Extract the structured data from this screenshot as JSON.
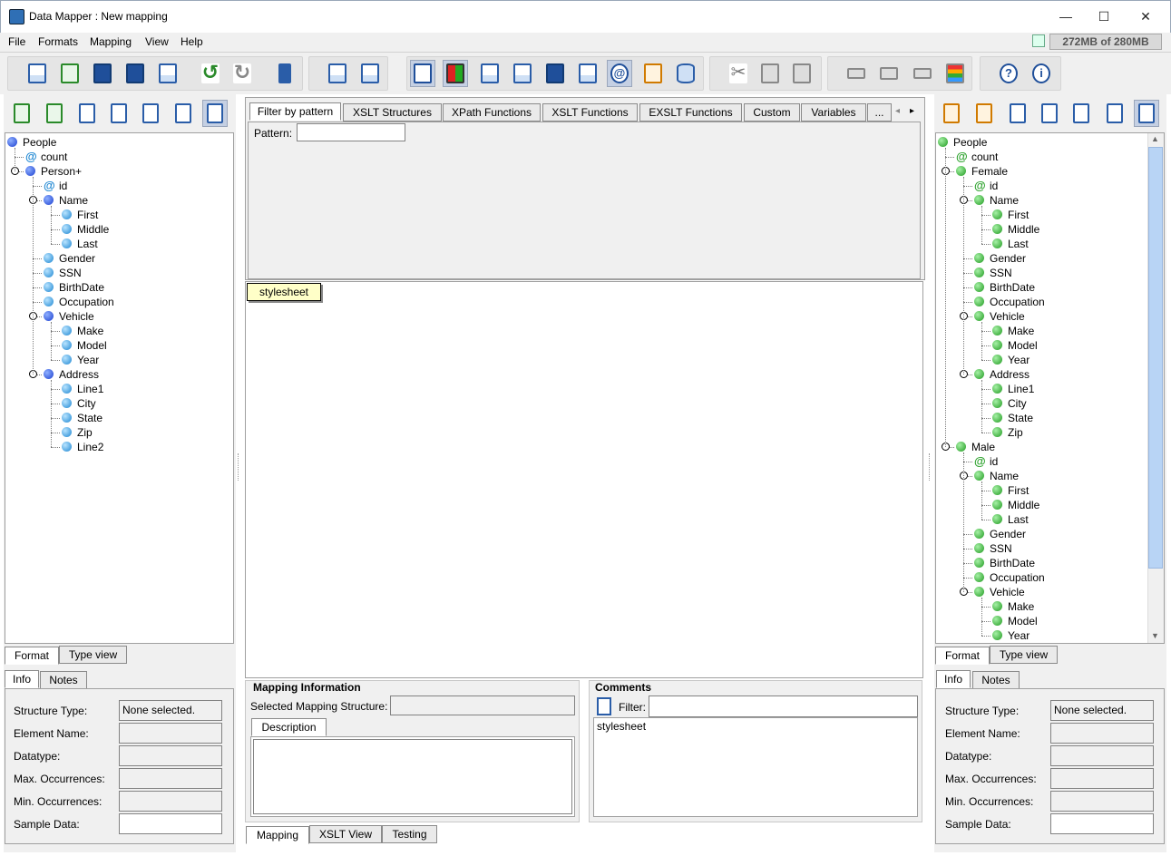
{
  "window": {
    "title": "Data Mapper : New mapping",
    "controls": {
      "minimize": "—",
      "maximize": "☐",
      "close": "✕"
    }
  },
  "menu": [
    "File",
    "Formats",
    "Mapping",
    "View",
    "Help"
  ],
  "memory": "272MB of 280MB",
  "toolbar": [
    "new-mapping-icon",
    "open-icon",
    "save-icon",
    "save-as-icon",
    "export-xls-icon",
    "undo-icon",
    "redo-icon",
    "exit-icon",
    "add-structure-icon",
    "structure-settings-icon",
    "show-info-icon",
    "show-colors-icon",
    "format-list-icon",
    "xml-icon",
    "save-database-icon",
    "list-icon",
    "xpath-icon",
    "table-icon",
    "database-icon",
    "cut-icon",
    "copy-icon",
    "paste-icon",
    "move-up-icon",
    "align-center-icon",
    "move-down-icon",
    "color-bars-icon",
    "help-icon",
    "info-icon"
  ],
  "left_tree": [
    {
      "label": "People",
      "type": "root"
    },
    {
      "label": "count",
      "type": "attr"
    },
    {
      "label": "Person+",
      "type": "root"
    },
    {
      "label": "id",
      "type": "attr"
    },
    {
      "label": "Name",
      "type": "root"
    },
    {
      "label": "First",
      "type": "leaf"
    },
    {
      "label": "Middle",
      "type": "leaf"
    },
    {
      "label": "Last",
      "type": "leaf"
    },
    {
      "label": "Gender",
      "type": "leaf"
    },
    {
      "label": "SSN",
      "type": "leaf"
    },
    {
      "label": "BirthDate",
      "type": "leaf"
    },
    {
      "label": "Occupation",
      "type": "leaf"
    },
    {
      "label": "Vehicle",
      "type": "root"
    },
    {
      "label": "Make",
      "type": "leaf"
    },
    {
      "label": "Model",
      "type": "leaf"
    },
    {
      "label": "Year",
      "type": "leaf"
    },
    {
      "label": "Address",
      "type": "root"
    },
    {
      "label": "Line1",
      "type": "leaf"
    },
    {
      "label": "City",
      "type": "leaf"
    },
    {
      "label": "State",
      "type": "leaf"
    },
    {
      "label": "Zip",
      "type": "leaf"
    },
    {
      "label": "Line2",
      "type": "leaf"
    }
  ],
  "right_tree": [
    {
      "label": "People",
      "type": "node"
    },
    {
      "label": "count",
      "type": "attr"
    },
    {
      "label": "Female",
      "type": "node"
    },
    {
      "label": "id",
      "type": "attr"
    },
    {
      "label": "Name",
      "type": "node"
    },
    {
      "label": "First",
      "type": "node"
    },
    {
      "label": "Middle",
      "type": "node"
    },
    {
      "label": "Last",
      "type": "node"
    },
    {
      "label": "Gender",
      "type": "node"
    },
    {
      "label": "SSN",
      "type": "node"
    },
    {
      "label": "BirthDate",
      "type": "node"
    },
    {
      "label": "Occupation",
      "type": "node"
    },
    {
      "label": "Vehicle",
      "type": "node"
    },
    {
      "label": "Make",
      "type": "node"
    },
    {
      "label": "Model",
      "type": "node"
    },
    {
      "label": "Year",
      "type": "node"
    },
    {
      "label": "Address",
      "type": "node"
    },
    {
      "label": "Line1",
      "type": "node"
    },
    {
      "label": "City",
      "type": "node"
    },
    {
      "label": "State",
      "type": "node"
    },
    {
      "label": "Zip",
      "type": "node"
    },
    {
      "label": "Male",
      "type": "node"
    },
    {
      "label": "id",
      "type": "attr"
    },
    {
      "label": "Name",
      "type": "node"
    },
    {
      "label": "First",
      "type": "node"
    },
    {
      "label": "Middle",
      "type": "node"
    },
    {
      "label": "Last",
      "type": "node"
    },
    {
      "label": "Gender",
      "type": "node"
    },
    {
      "label": "SSN",
      "type": "node"
    },
    {
      "label": "BirthDate",
      "type": "node"
    },
    {
      "label": "Occupation",
      "type": "node"
    },
    {
      "label": "Vehicle",
      "type": "node"
    },
    {
      "label": "Make",
      "type": "node"
    },
    {
      "label": "Model",
      "type": "node"
    },
    {
      "label": "Year",
      "type": "node"
    }
  ],
  "tree_tabs": {
    "format": "Format",
    "type_view": "Type view"
  },
  "info_tabs": {
    "info": "Info",
    "notes": "Notes"
  },
  "info_fields": {
    "structure_type": {
      "label": "Structure Type:",
      "value": "None selected."
    },
    "element_name": "Element Name:",
    "datatype": "Datatype:",
    "max_occ": "Max. Occurrences:",
    "min_occ": "Min. Occurrences:",
    "sample": "Sample Data:"
  },
  "function_tabs": [
    "Filter by pattern",
    "XSLT Structures",
    "XPath Functions",
    "XSLT Functions",
    "EXSLT Functions",
    "Custom",
    "Variables",
    "..."
  ],
  "pattern_label": "Pattern:",
  "pattern_value": "",
  "canvas_node": "stylesheet",
  "mapping_info": {
    "title": "Mapping Information",
    "selected_label": "Selected Mapping Structure:",
    "selected_value": "",
    "description_tab": "Description"
  },
  "comments": {
    "title": "Comments",
    "filter_label": "Filter:",
    "filter_value": "",
    "items": [
      "stylesheet"
    ]
  },
  "bottom_tabs": [
    "Mapping",
    "XSLT View",
    "Testing"
  ]
}
